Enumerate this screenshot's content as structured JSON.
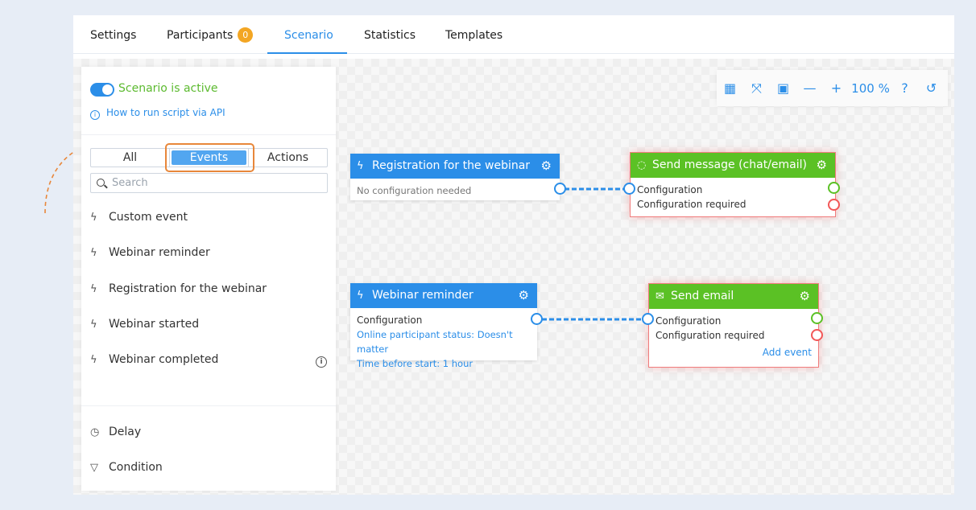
{
  "tabs": [
    {
      "label": "Settings"
    },
    {
      "label": "Participants",
      "badge": "0"
    },
    {
      "label": "Scenario"
    },
    {
      "label": "Statistics"
    },
    {
      "label": "Templates"
    }
  ],
  "active_tab": "Scenario",
  "panel": {
    "status_label": "Scenario is active",
    "api_link": "How to run script via API",
    "segments": [
      "All",
      "Events",
      "Actions"
    ],
    "selected_segment": "Events",
    "search_placeholder": "Search",
    "events": [
      {
        "label": "Custom event"
      },
      {
        "label": "Webinar reminder"
      },
      {
        "label": "Registration for the webinar"
      },
      {
        "label": "Webinar started"
      },
      {
        "label": "Webinar completed"
      }
    ],
    "extras": [
      {
        "label": "Delay",
        "icon": "clock-icon"
      },
      {
        "label": "Condition",
        "icon": "filter-icon"
      }
    ]
  },
  "nodes": {
    "registration": {
      "title": "Registration for the webinar",
      "body": "No configuration needed"
    },
    "send_message": {
      "title": "Send message (chat/email)",
      "config": "Configuration",
      "required": "Configuration required"
    },
    "reminder": {
      "title": "Webinar reminder",
      "config": "Configuration",
      "line1": "Online participant status: Doesn't matter",
      "line2": "Time before start: 1 hour"
    },
    "send_email": {
      "title": "Send email",
      "config": "Configuration",
      "required": "Configuration required",
      "add_event": "Add event"
    }
  },
  "toolbar": {
    "zoom": "100 %"
  },
  "colors": {
    "accent": "#2b8ee8",
    "success": "#5bc125",
    "error": "#f25757",
    "badge": "#f3a623",
    "highlight": "#e8873a"
  }
}
